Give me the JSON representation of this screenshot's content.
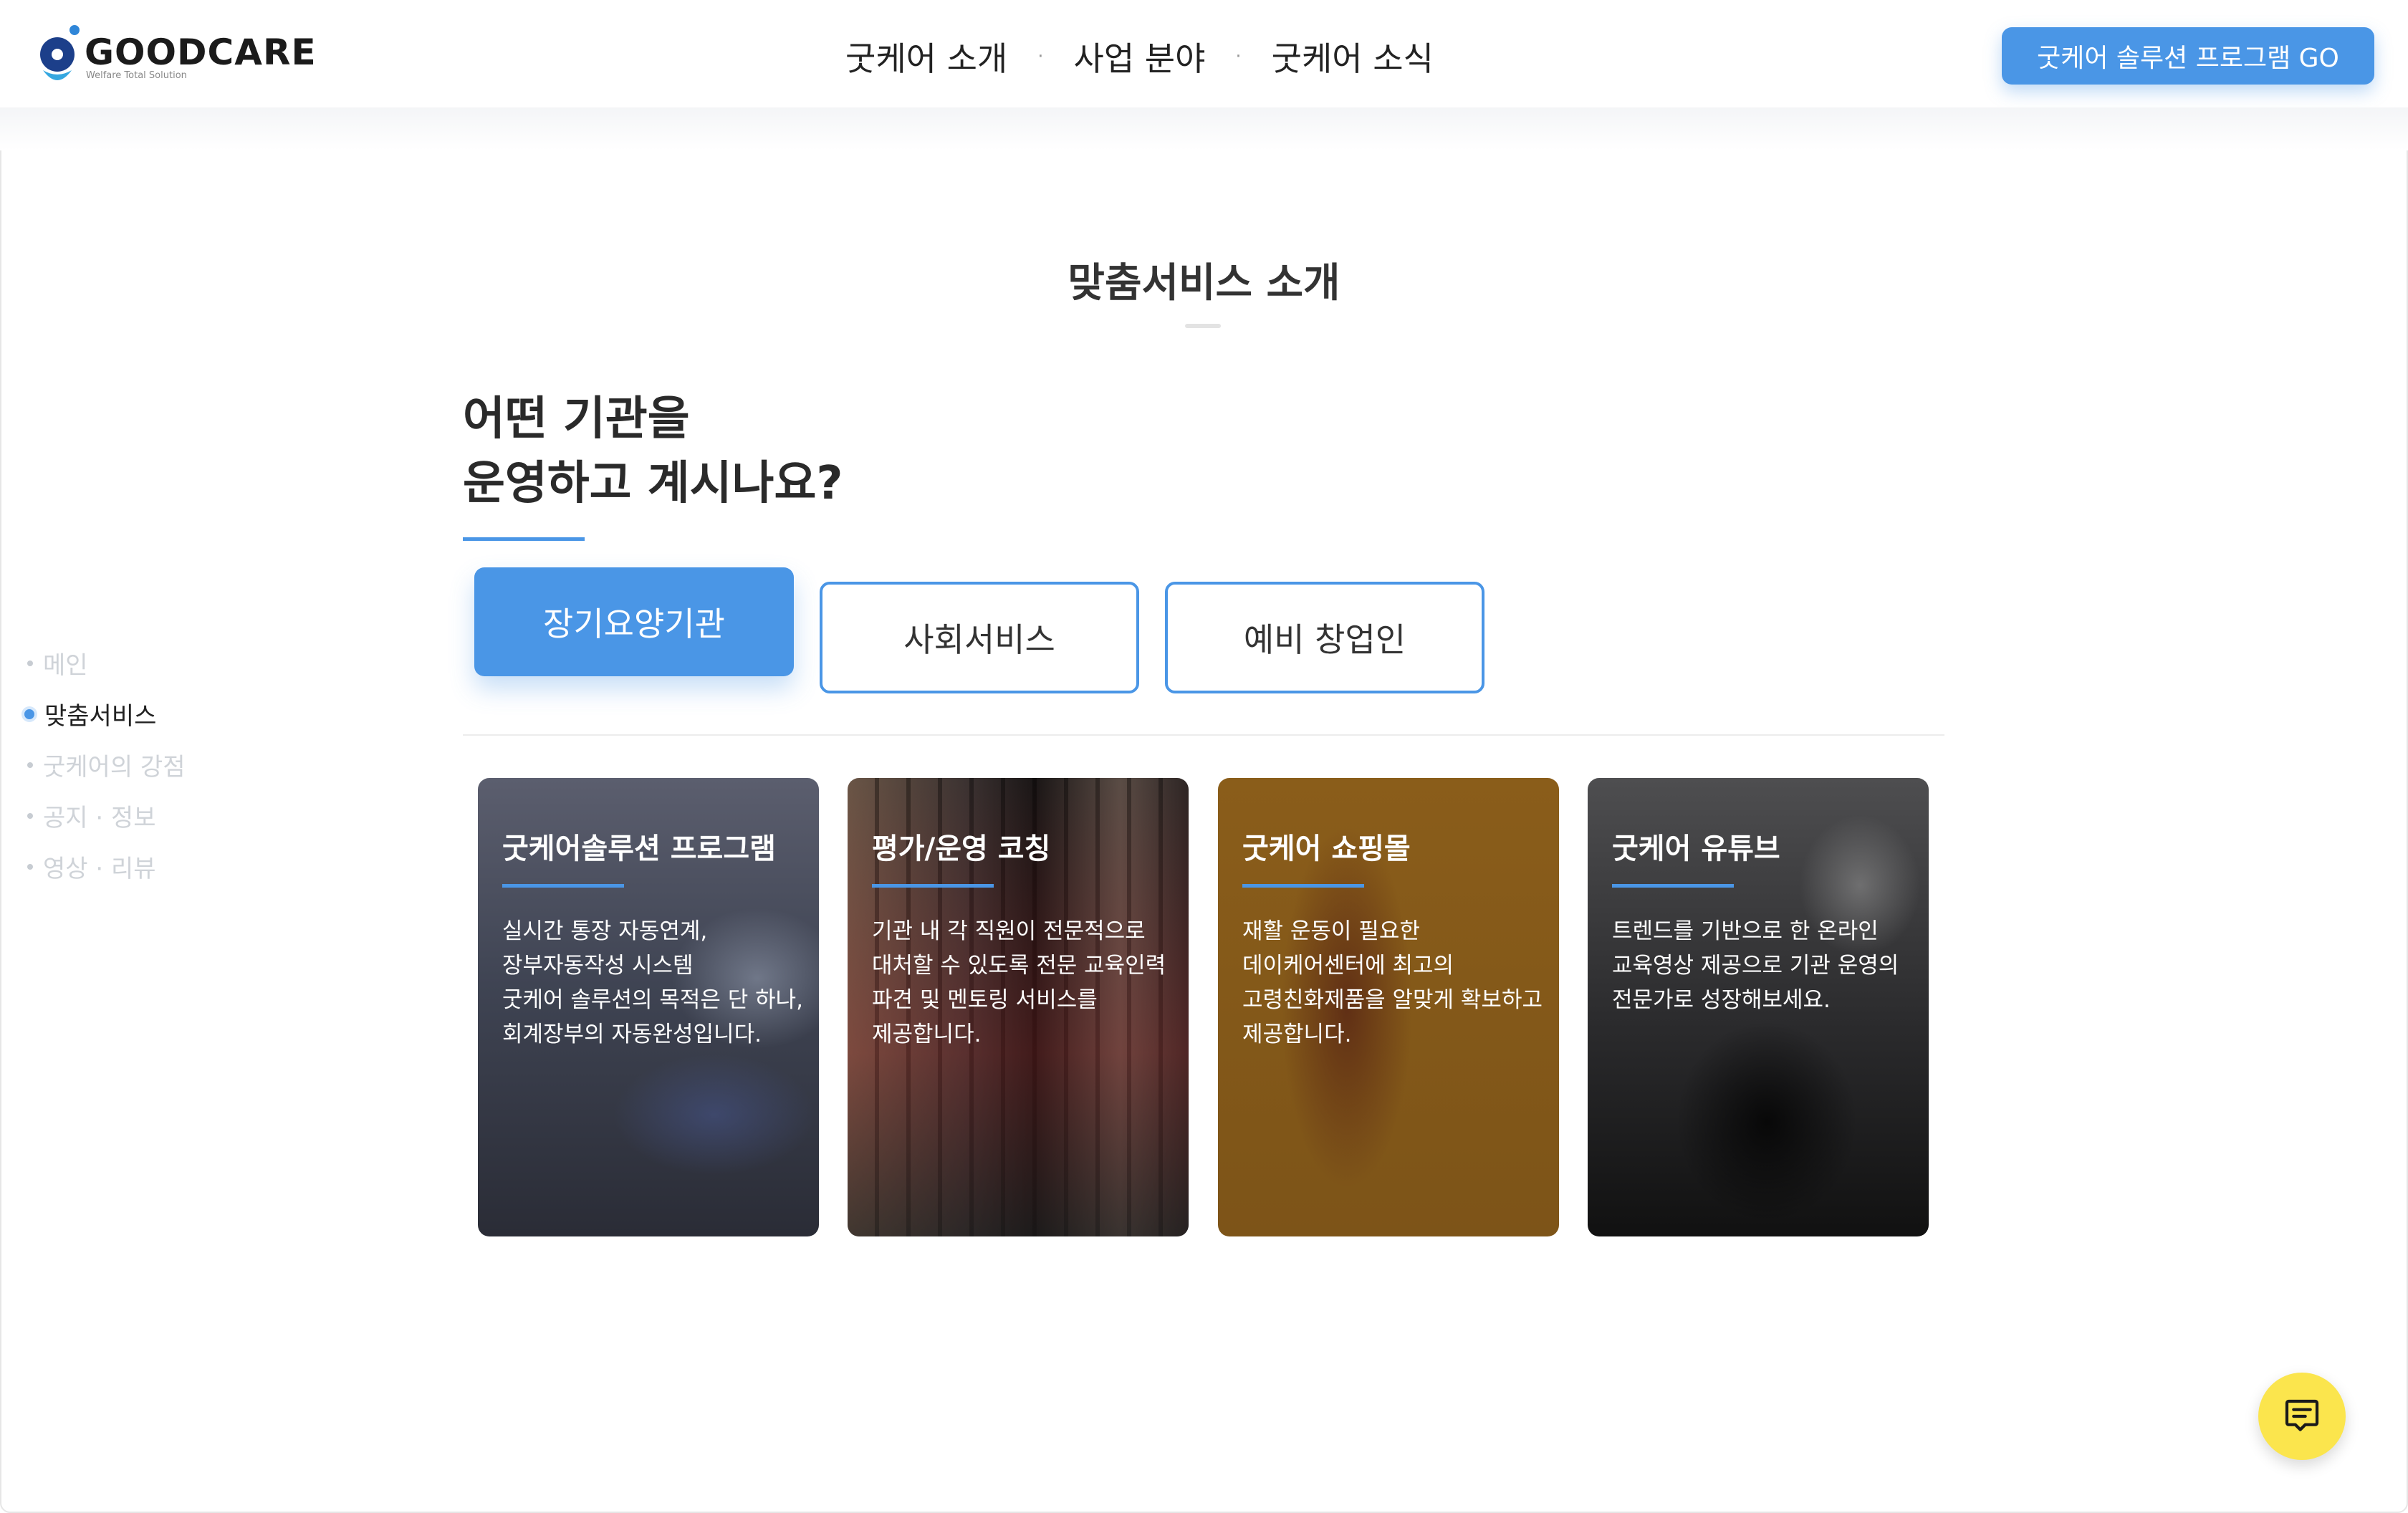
{
  "brand": {
    "name": "GOODCARE",
    "tagline": "Welfare Total Solution",
    "accent": "#4a96e6"
  },
  "header": {
    "nav": [
      {
        "label": "굿케어 소개"
      },
      {
        "label": "사업 분야"
      },
      {
        "label": "굿케어 소식"
      }
    ],
    "nav_separator": "·",
    "cta_label": "굿케어 솔루션 프로그램 GO"
  },
  "section": {
    "title": "맞춤서비스 소개"
  },
  "sidebar": {
    "items": [
      {
        "label": "메인",
        "active": false
      },
      {
        "label": "맞춤서비스",
        "active": true
      },
      {
        "label": "굿케어의 강점",
        "active": false
      },
      {
        "label": "공지 · 정보",
        "active": false
      },
      {
        "label": "영상 · 리뷰",
        "active": false
      }
    ]
  },
  "question": {
    "line1": "어떤 기관을",
    "line2": "운영하고 계시나요?"
  },
  "tabs": [
    {
      "label": "장기요양기관",
      "selected": true
    },
    {
      "label": "사회서비스",
      "selected": false
    },
    {
      "label": "예비 창업인",
      "selected": false
    }
  ],
  "cards": [
    {
      "title": "굿케어솔루션 프로그램",
      "lines": [
        "실시간 통장 자동연계,",
        "장부자동작성 시스템",
        "굿케어 솔루션의 목적은 단 하나,",
        "회계장부의 자동완성입니다."
      ]
    },
    {
      "title": "평가/운영 코칭",
      "lines": [
        "기관 내 각 직원이 전문적으로",
        "대처할 수 있도록 전문 교육인력",
        "파견 및 멘토링 서비스를",
        "제공합니다."
      ]
    },
    {
      "title": "굿케어 쇼핑몰",
      "lines": [
        "재활 운동이 필요한",
        "데이케어센터에 최고의",
        "고령친화제품을 알맞게 확보하고",
        "제공합니다."
      ]
    },
    {
      "title": "굿케어 유튜브",
      "lines": [
        "트렌드를 기반으로 한 온라인",
        "교육영상 제공으로 기관 운영의",
        "전문가로 성장해보세요."
      ]
    }
  ],
  "chat": {
    "icon": "chat-icon",
    "color": "#fbe54d"
  }
}
